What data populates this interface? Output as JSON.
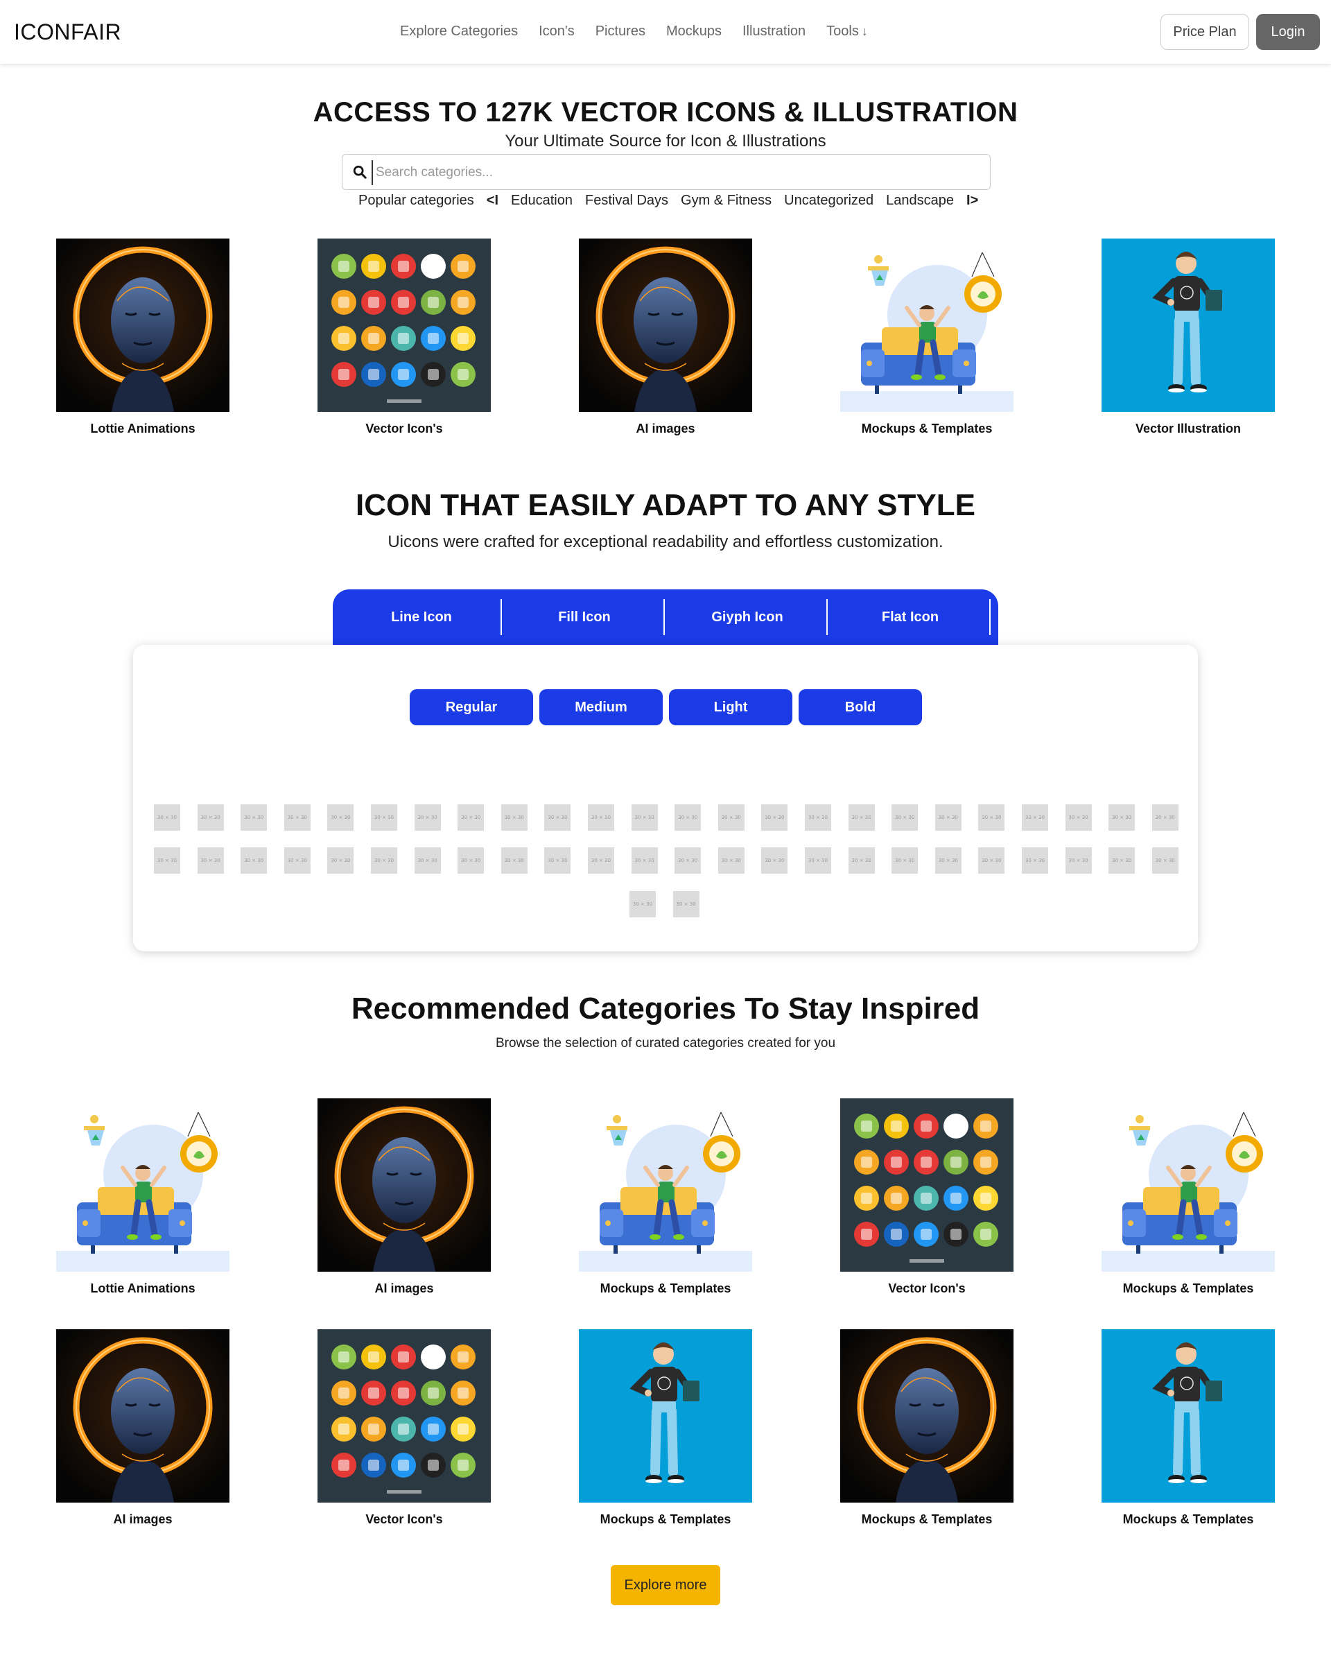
{
  "nav": {
    "brand": "ICONFAIR",
    "links": [
      "Explore Categories",
      "Icon's",
      "Pictures",
      "Mockups",
      "Illustration",
      "Tools"
    ],
    "price_label": "Price Plan",
    "login_label": "Login"
  },
  "hero": {
    "title": "ACCESS TO 127K VECTOR ICONS & ILLUSTRATION",
    "subtitle": "Your Ultimate Source for Icon & Illustrations",
    "search_placeholder": "Search categories...",
    "popular_label": "Popular categories",
    "prev": "<I",
    "next": "I>",
    "popular": [
      "Education",
      "Festival Days",
      "Gym & Fitness",
      "Uncategorized",
      "Landscape"
    ]
  },
  "top_categories": [
    {
      "label": "Lottie Animations",
      "image": "robot-portrait"
    },
    {
      "label": "Vector Icon's",
      "image": "icon-grid"
    },
    {
      "label": "AI images",
      "image": "robot-portrait"
    },
    {
      "label": "Mockups & Templates",
      "image": "sofa-person"
    },
    {
      "label": "Vector Illustration",
      "image": "standing-person"
    }
  ],
  "style_section": {
    "title": "ICON THAT EASILY ADAPT TO ANY STYLE",
    "subtitle": "Uicons were crafted for exceptional readability and effortless customization.",
    "tabs": [
      "Line Icon",
      "Fill Icon",
      "Giyph Icon",
      "Flat Icon"
    ],
    "weights": [
      "Regular",
      "Medium",
      "Light",
      "Bold"
    ],
    "placeholder_text": "30 × 30"
  },
  "recommended": {
    "title": "Recommended Categories To Stay Inspired",
    "subtitle": "Browse the selection of curated categories created for you",
    "items": [
      {
        "label": "Lottie Animations",
        "image": "sofa-person"
      },
      {
        "label": "AI images",
        "image": "robot-portrait"
      },
      {
        "label": "Mockups & Templates",
        "image": "sofa-person"
      },
      {
        "label": "Vector Icon's",
        "image": "icon-grid"
      },
      {
        "label": "Mockups & Templates",
        "image": "sofa-person"
      },
      {
        "label": "AI images",
        "image": "robot-portrait"
      },
      {
        "label": "Vector Icon's",
        "image": "icon-grid"
      },
      {
        "label": "Mockups & Templates",
        "image": "standing-person"
      },
      {
        "label": "Mockups & Templates",
        "image": "robot-portrait"
      },
      {
        "label": "Mockups & Templates",
        "image": "standing-person"
      }
    ],
    "explore_label": "Explore more"
  },
  "colors": {
    "accent_blue": "#1a3be6",
    "explore_yellow": "#f5b400",
    "login_gray": "#666666"
  }
}
